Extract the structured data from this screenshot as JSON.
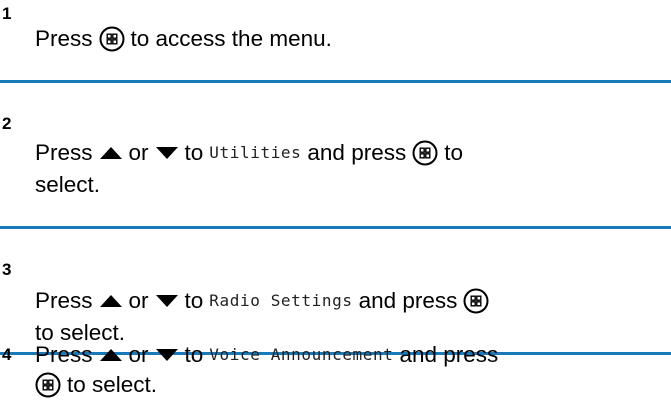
{
  "steps": [
    {
      "number": "1",
      "press": "Press",
      "tail": "to access the menu."
    },
    {
      "number": "2",
      "press": "Press",
      "or": "or",
      "to": "to",
      "menu_item": "Utilities",
      "and_press": "and press",
      "to_end": "to",
      "line2": "select."
    },
    {
      "number": "3",
      "press": "Press",
      "or": "or",
      "to": "to",
      "menu_item": "Radio Settings",
      "and_press": "and press",
      "line2": "to select."
    },
    {
      "number": "4",
      "press": "Press",
      "or": "or",
      "to": "to",
      "menu_item": "Voice Announcement",
      "and_press": "and press",
      "line2": "to select."
    }
  ],
  "icons": {
    "menu_ok": "menu-ok-button-icon",
    "up": "up-arrow-icon",
    "down": "down-arrow-icon"
  },
  "colors": {
    "separator": "#1979b9",
    "text": "#000000"
  }
}
